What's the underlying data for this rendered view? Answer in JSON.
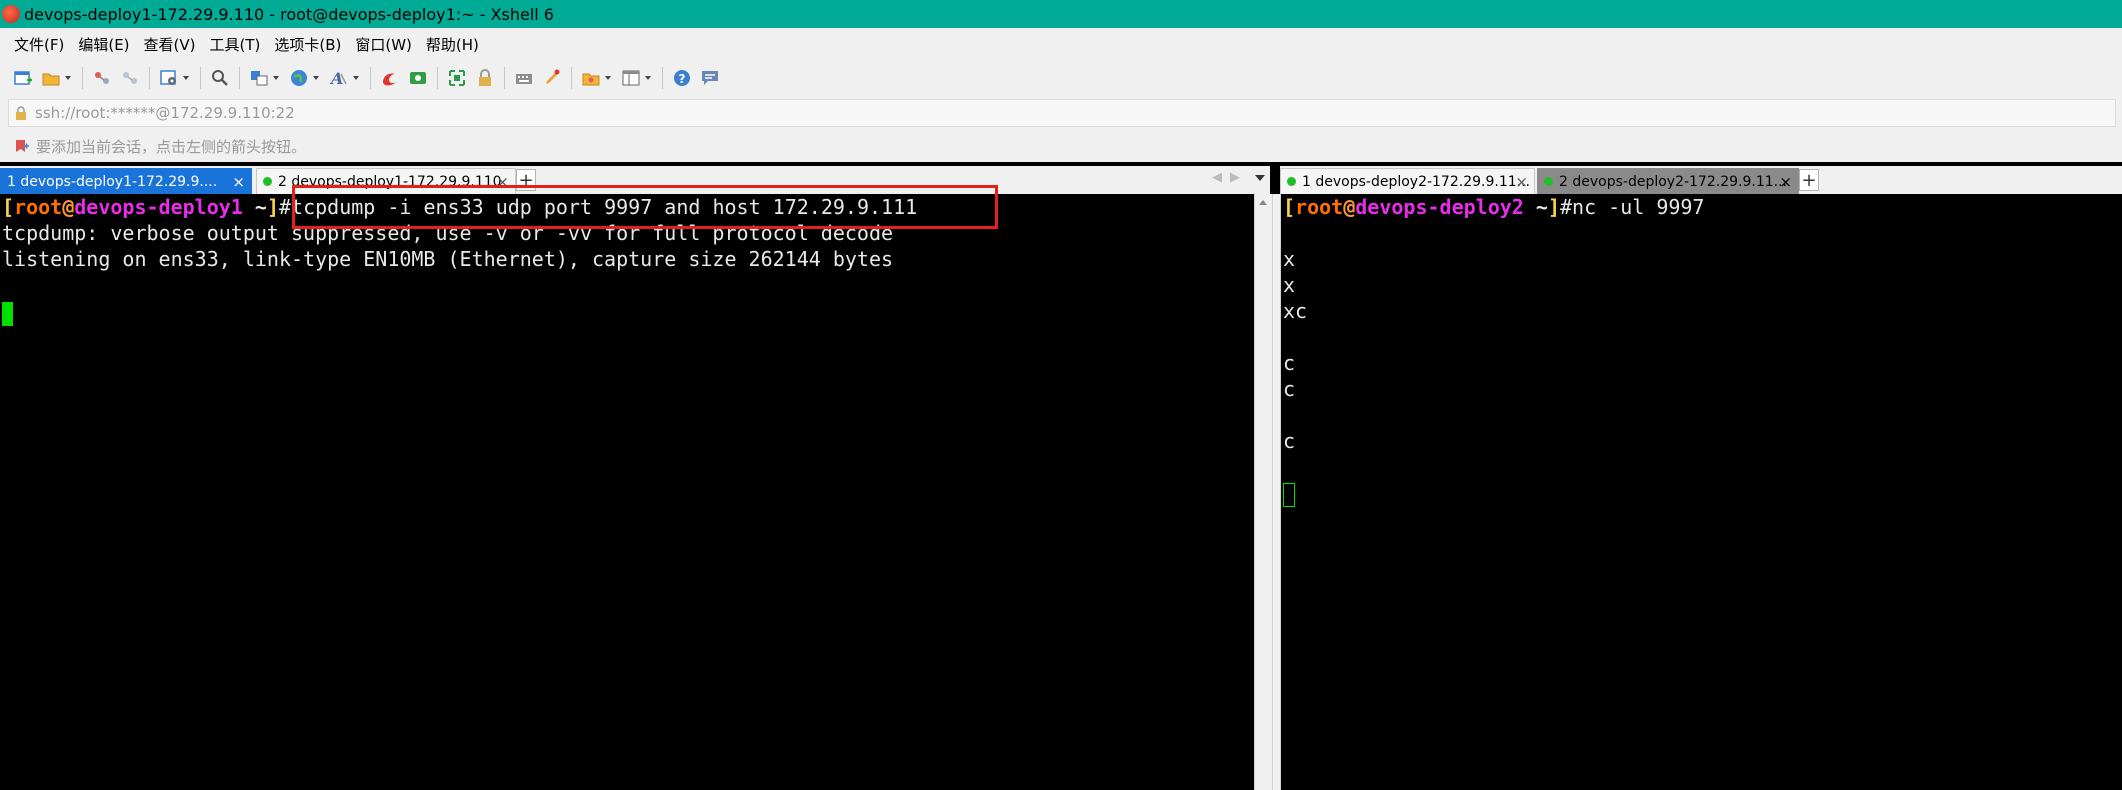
{
  "window": {
    "title": "devops-deploy1-172.29.9.110 - root@devops-deploy1:~ - Xshell 6"
  },
  "menu": [
    {
      "label": "文件(F)"
    },
    {
      "label": "编辑(E)"
    },
    {
      "label": "查看(V)"
    },
    {
      "label": "工具(T)"
    },
    {
      "label": "选项卡(B)"
    },
    {
      "label": "窗口(W)"
    },
    {
      "label": "帮助(H)"
    }
  ],
  "address": {
    "value": "ssh://root:******@172.29.9.110:22"
  },
  "hint": {
    "text": "要添加当前会话，点击左侧的箭头按钮。"
  },
  "left_tabs": [
    {
      "label": "1 devops-deploy1-172.29.9....",
      "close": "×"
    },
    {
      "label": "2 devops-deploy1-172.29.9.110",
      "close": "×"
    }
  ],
  "right_tabs": [
    {
      "label": "1 devops-deploy2-172.29.9.11...",
      "close": "×"
    },
    {
      "label": "2 devops-deploy2-172.29.9.11...",
      "close": "×"
    }
  ],
  "tab_add_symbol": "+",
  "left_terminal": {
    "prompt": {
      "open": "[",
      "user": "root",
      "at": "@",
      "host": "devops-deploy1",
      "path": " ~",
      "close": "]",
      "command": "#tcpdump -i ens33 udp port 9997 and host 172.29.9.111"
    },
    "lines": [
      "tcpdump: verbose output suppressed, use -v or -vv for full protocol decode",
      "listening on ens33, link-type EN10MB (Ethernet), capture size 262144 bytes"
    ]
  },
  "right_terminal": {
    "prompt": {
      "open": "[",
      "user": "root",
      "at": "@",
      "host": "devops-deploy2",
      "path": " ~",
      "close": "]",
      "command": "#nc -ul 9997"
    },
    "lines": [
      "",
      "x",
      "x",
      "xc",
      "",
      "c",
      "c",
      "",
      "c",
      "",
      ""
    ]
  },
  "colors": {
    "titlebar": "#00ab95",
    "active_tab": "#1a73d9",
    "highlight": "#e2211c",
    "cursor": "#00e000"
  }
}
